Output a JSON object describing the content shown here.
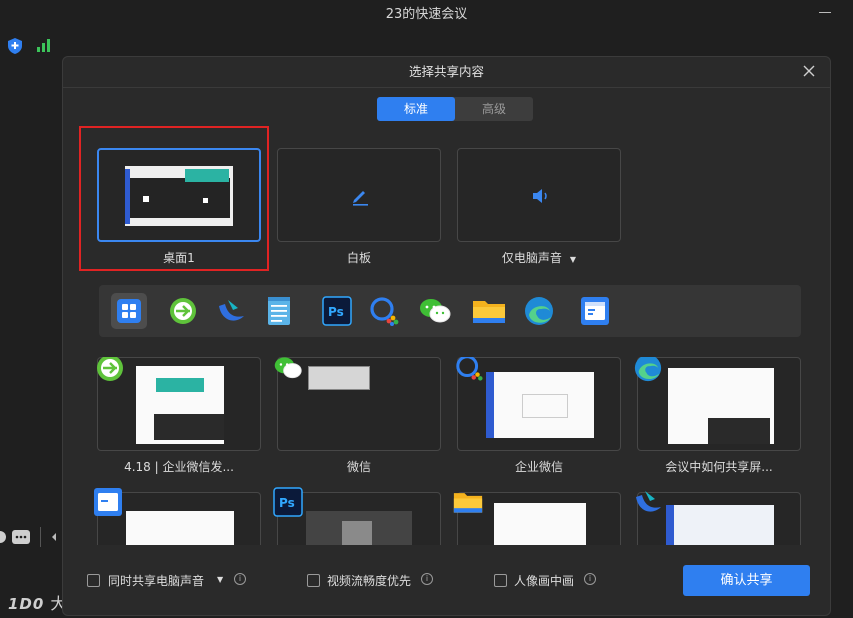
{
  "window": {
    "title": "23的快速会议"
  },
  "watermark": {
    "logo": "1D0",
    "text": "大数跨境"
  },
  "dialog": {
    "title": "选择共享内容",
    "tabs": [
      {
        "label": "标准",
        "active": true
      },
      {
        "label": "高级",
        "active": false
      }
    ],
    "tiles": [
      {
        "label": "桌面1",
        "icon": "desktop-thumbnail"
      },
      {
        "label": "白板",
        "icon": "pencil-icon"
      },
      {
        "label": "仅电脑声音",
        "icon": "speaker-icon"
      }
    ],
    "apps": [
      {
        "name": "all-windows-icon"
      },
      {
        "name": "green-browser-icon"
      },
      {
        "name": "wecom-blue-icon"
      },
      {
        "name": "notepad-icon"
      },
      {
        "name": "photoshop-icon",
        "text": "Ps"
      },
      {
        "name": "wecom-icon"
      },
      {
        "name": "wechat-icon"
      },
      {
        "name": "folder-icon"
      },
      {
        "name": "edge-icon"
      },
      {
        "name": "window-icon"
      }
    ],
    "windows": [
      {
        "label": "4.18 | 企业微信发..."
      },
      {
        "label": "微信"
      },
      {
        "label": "企业微信"
      },
      {
        "label": "会议中如何共享屏..."
      }
    ],
    "footer": {
      "options": [
        {
          "label": "同时共享电脑声音"
        },
        {
          "label": "视频流畅度优先"
        },
        {
          "label": "人像画中画"
        }
      ],
      "confirm": "确认共享"
    }
  },
  "colors": {
    "accent": "#2f7ff0",
    "highlight": "#e02323",
    "dialog_bg": "#2a2a2a"
  }
}
